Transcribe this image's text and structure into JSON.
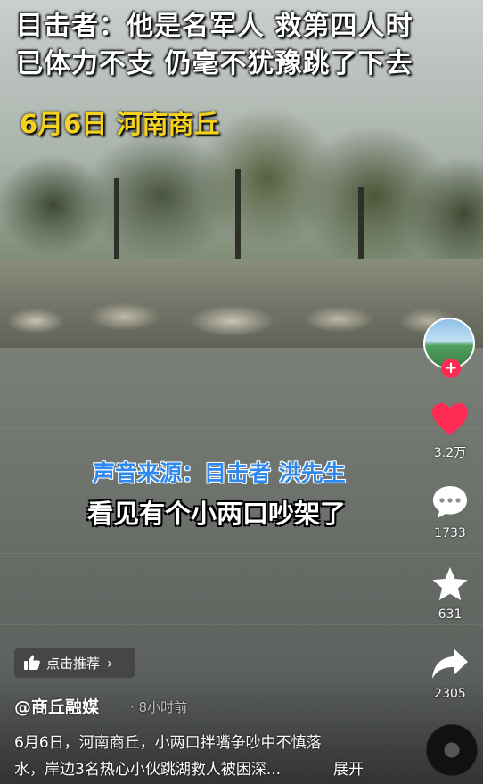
{
  "video": {
    "headline_line1": "目击者：他是名军人 救第四人时",
    "headline_line2": "已体力不支 仍毫不犹豫跳了下去",
    "date_location": "6月6日 河南商丘",
    "subtitle_source": "声音来源：目击者 洪先生",
    "subtitle_text": "看见有个小两口吵架了"
  },
  "actions": {
    "follow_symbol": "+",
    "like_count": "3.2万",
    "comment_count": "1733",
    "favorite_count": "631",
    "share_count": "2305"
  },
  "promo": {
    "label": "点击推荐",
    "chevron": "›"
  },
  "post": {
    "author": "@商丘融媒",
    "time": "· 8小时前",
    "description_line1": "6月6日，河南商丘，小两口拌嘴争吵中不慎落",
    "description_line2": "水，岸边3名热心小伙跳湖救人被困深...",
    "expand": "展开"
  },
  "colors": {
    "headline": "#ffffff",
    "date": "#f5d21e",
    "subtitle_source": "#2f8af0",
    "like": "#fe2c55"
  },
  "icons": [
    "heart-icon",
    "comment-icon",
    "star-icon",
    "share-icon",
    "thumbs-up-icon",
    "music-disc-icon"
  ]
}
